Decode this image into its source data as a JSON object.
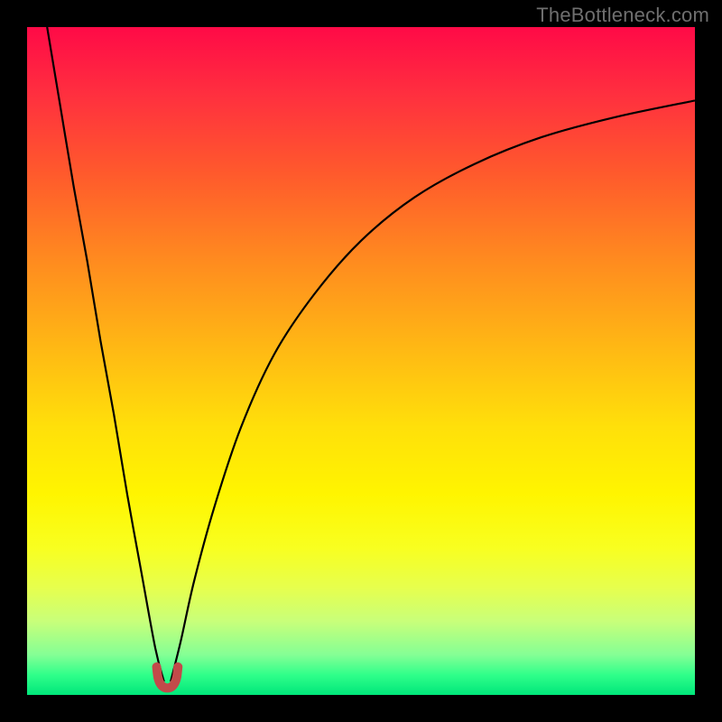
{
  "attribution": "TheBottleneck.com",
  "colors": {
    "curve_stroke": "#000000",
    "marker_stroke": "#c24a4a",
    "gradient_top": "#ff0a47",
    "gradient_bottom": "#00e67a",
    "frame_bg": "#000000"
  },
  "chart_data": {
    "type": "line",
    "title": "",
    "xlabel": "",
    "ylabel": "",
    "xlim": [
      0,
      100
    ],
    "ylim": [
      0,
      100
    ],
    "grid": false,
    "legend": false,
    "min_x": 21,
    "series": [
      {
        "name": "left_branch",
        "x": [
          3.0,
          5.0,
          7.0,
          9.0,
          11.0,
          13.0,
          15.0,
          17.0,
          19.2,
          20.5
        ],
        "values": [
          100,
          88,
          76,
          65,
          53,
          42,
          30,
          19,
          7,
          2.0
        ]
      },
      {
        "name": "right_branch",
        "x": [
          21.5,
          23.0,
          25.0,
          28.0,
          32.0,
          37.0,
          43.0,
          50.0,
          58.0,
          67.0,
          77.0,
          88.0,
          100.0
        ],
        "values": [
          2.0,
          8.0,
          17.0,
          28.0,
          40.0,
          51.0,
          60.0,
          68.0,
          74.5,
          79.5,
          83.5,
          86.5,
          89.0
        ]
      },
      {
        "name": "bottom_marker",
        "x": [
          19.4,
          19.6,
          20.0,
          20.6,
          21.4,
          22.0,
          22.4,
          22.6
        ],
        "values": [
          4.2,
          2.6,
          1.6,
          1.1,
          1.1,
          1.6,
          2.6,
          4.2
        ]
      }
    ],
    "marker_style": {
      "stroke_width": 10,
      "stroke": "#c24a4a"
    }
  }
}
